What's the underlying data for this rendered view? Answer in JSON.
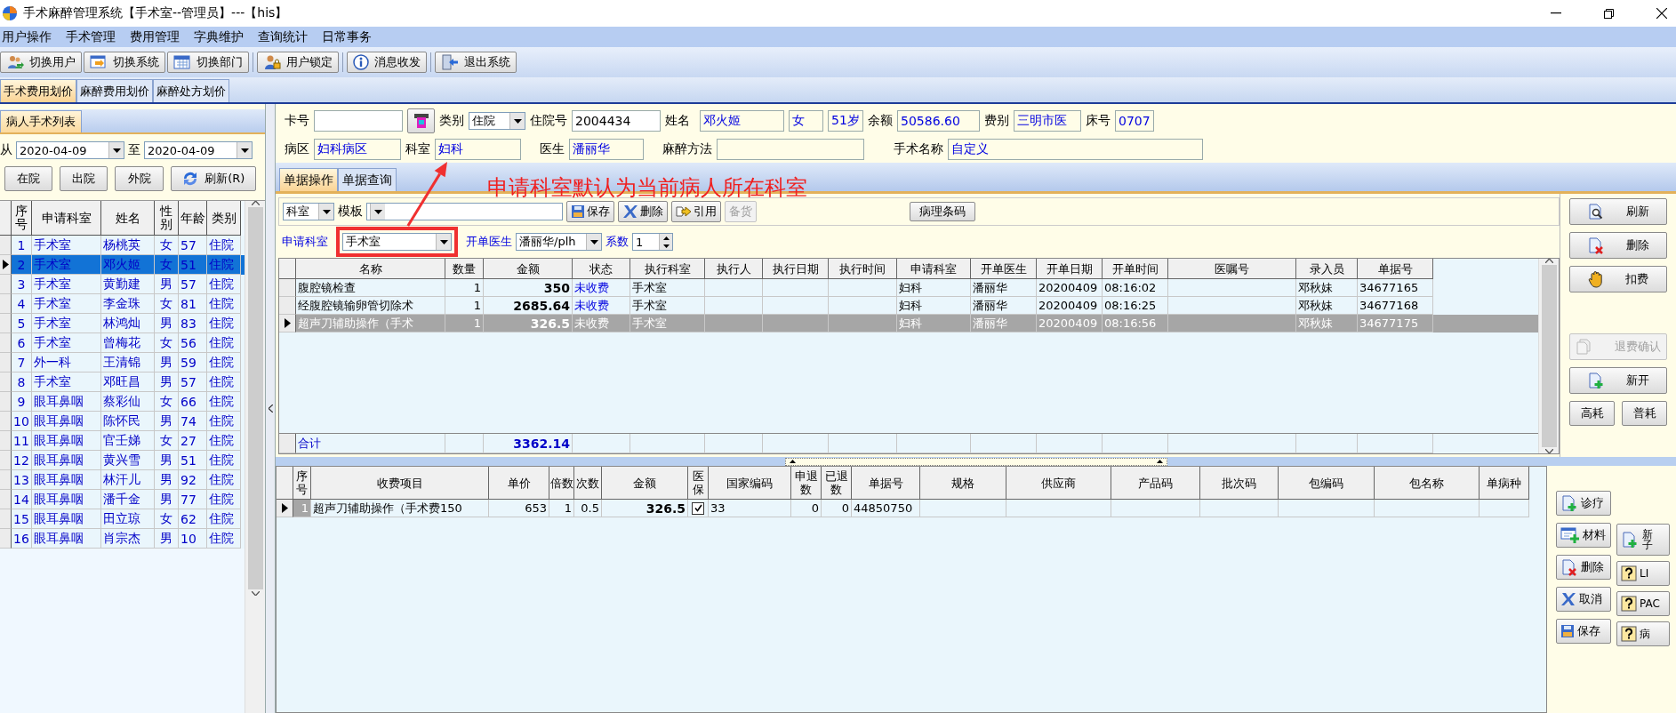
{
  "window": {
    "title": "手术麻醉管理系统【手术室--管理员】---【his】"
  },
  "menu": [
    "用户操作",
    "手术管理",
    "费用管理",
    "字典维护",
    "查询统计",
    "日常事务"
  ],
  "toolbar": [
    "切换用户",
    "切换系统",
    "切换部门",
    "用户锁定",
    "消息收发",
    "退出系统"
  ],
  "main_tabs": [
    {
      "label": "手术费用划价",
      "selected": true
    },
    {
      "label": "麻醉费用划价",
      "selected": false
    },
    {
      "label": "麻醉处方划价",
      "selected": false
    }
  ],
  "left_panel": {
    "title": "病人手术列表",
    "from_label": "从",
    "from_date": "2020-04-09",
    "to_label": "至",
    "to_date": "2020-04-09",
    "buttons": [
      "在院",
      "出院",
      "外院"
    ],
    "refresh_button": "刷新(R)",
    "columns": [
      "序号",
      "申请科室",
      "姓名",
      "性别",
      "年龄",
      "类别"
    ],
    "rows": [
      {
        "cells": [
          "1",
          "手术室",
          "杨桃英",
          "女",
          "57",
          "住院"
        ],
        "selected": false
      },
      {
        "cells": [
          "2",
          "手术室",
          "邓火姬",
          "女",
          "51",
          "住院"
        ],
        "selected": true
      },
      {
        "cells": [
          "3",
          "手术室",
          "黄勤建",
          "男",
          "57",
          "住院"
        ],
        "selected": false
      },
      {
        "cells": [
          "4",
          "手术室",
          "李金珠",
          "女",
          "81",
          "住院"
        ],
        "selected": false
      },
      {
        "cells": [
          "5",
          "手术室",
          "林鸿灿",
          "男",
          "83",
          "住院"
        ],
        "selected": false
      },
      {
        "cells": [
          "6",
          "手术室",
          "曾梅花",
          "女",
          "56",
          "住院"
        ],
        "selected": false
      },
      {
        "cells": [
          "7",
          "外一科",
          "王清锦",
          "男",
          "59",
          "住院"
        ],
        "selected": false
      },
      {
        "cells": [
          "8",
          "手术室",
          "邓旺昌",
          "男",
          "57",
          "住院"
        ],
        "selected": false
      },
      {
        "cells": [
          "9",
          "眼耳鼻咽",
          "蔡彩仙",
          "女",
          "66",
          "住院"
        ],
        "selected": false
      },
      {
        "cells": [
          "10",
          "眼耳鼻咽",
          "陈怀民",
          "男",
          "74",
          "住院"
        ],
        "selected": false
      },
      {
        "cells": [
          "11",
          "眼耳鼻咽",
          "官壬娣",
          "女",
          "27",
          "住院"
        ],
        "selected": false
      },
      {
        "cells": [
          "12",
          "眼耳鼻咽",
          "黄兴雪",
          "男",
          "51",
          "住院"
        ],
        "selected": false
      },
      {
        "cells": [
          "13",
          "眼耳鼻咽",
          "林汗儿",
          "男",
          "92",
          "住院"
        ],
        "selected": false
      },
      {
        "cells": [
          "14",
          "眼耳鼻咽",
          "潘千金",
          "男",
          "77",
          "住院"
        ],
        "selected": false
      },
      {
        "cells": [
          "15",
          "眼耳鼻咽",
          "田立琼",
          "女",
          "62",
          "住院"
        ],
        "selected": false
      },
      {
        "cells": [
          "16",
          "眼耳鼻咽",
          "肖宗杰",
          "男",
          "10",
          "住院"
        ],
        "selected": false
      }
    ]
  },
  "patient_form": {
    "first_line": [
      {
        "kind": "input",
        "label": "卡号"
      },
      {
        "kind": "reader"
      },
      {
        "kind": "combo",
        "label": "类别",
        "value": "住院"
      },
      {
        "kind": "input",
        "label": "住院号",
        "value": "2004434"
      },
      {
        "kind": "display",
        "label": "姓名",
        "value": "邓火姬"
      },
      {
        "kind": "display",
        "value": "女"
      },
      {
        "kind": "display",
        "value": "51岁"
      },
      {
        "kind": "display",
        "label": "余额",
        "value": "50586.60"
      },
      {
        "kind": "display",
        "label": "费别",
        "value": "三明市医"
      },
      {
        "kind": "display",
        "label": "床号",
        "value": "0707"
      }
    ],
    "second_line": [
      {
        "kind": "display",
        "label": "病区",
        "value": "妇科病区"
      },
      {
        "kind": "display",
        "label": "科室",
        "value": "妇科"
      },
      {
        "kind": "display",
        "label": "医生",
        "value": "潘丽华"
      },
      {
        "kind": "display",
        "label": "麻醉方法"
      },
      {
        "kind": "display",
        "label": "手术名称",
        "value": "自定义"
      }
    ]
  },
  "annotation": {
    "text": "申请科室默认为当前病人所在科室"
  },
  "sub_tabs": [
    {
      "label": "单据操作",
      "selected": true
    },
    {
      "label": "单据查询",
      "selected": false
    }
  ],
  "order_toolbar": {
    "dept_combo": "科室",
    "template_label": "模板",
    "buttons": [
      {
        "label": "保存",
        "disabled": false
      },
      {
        "label": "删除",
        "disabled": false
      },
      {
        "label": "引用",
        "disabled": false
      },
      {
        "label": "备货",
        "disabled": true
      }
    ],
    "pathology_button": "病理条码"
  },
  "order_filter": {
    "dept_label": "申请科室",
    "dept_value": "手术室",
    "doctor_label": "开单医生",
    "doctor_value": "潘丽华/plh",
    "factor_label": "系数",
    "factor_value": "1"
  },
  "orders": {
    "columns": [
      "名称",
      "数量",
      "金额",
      "状态",
      "执行科室",
      "执行人",
      "执行日期",
      "执行时间",
      "申请科室",
      "开单医生",
      "开单日期",
      "开单时间",
      "医嘱号",
      "录入员",
      "单据号"
    ],
    "rows": [
      {
        "selected": false,
        "cells": [
          "腹腔镜检查",
          "1",
          "350",
          "未收费",
          "手术室",
          "",
          "",
          "",
          "妇科",
          "潘丽华",
          "20200409",
          "08:16:02",
          "",
          "邓秋妹",
          "34677165"
        ]
      },
      {
        "selected": false,
        "cells": [
          "经腹腔镜输卵管切除术",
          "1",
          "2685.64",
          "未收费",
          "手术室",
          "",
          "",
          "",
          "妇科",
          "潘丽华",
          "20200409",
          "08:16:25",
          "",
          "邓秋妹",
          "34677168"
        ]
      },
      {
        "selected": true,
        "cells": [
          "超声刀辅助操作（手术",
          "1",
          "326.5",
          "未收费",
          "手术室",
          "",
          "",
          "",
          "妇科",
          "潘丽华",
          "20200409",
          "08:16:56",
          "",
          "邓秋妹",
          "34677175"
        ]
      }
    ],
    "total": {
      "label": "合计",
      "amount": "3362.14"
    }
  },
  "order_buttons": [
    {
      "label": "刷新",
      "disabled": false
    },
    {
      "label": "删除",
      "disabled": false
    },
    {
      "label": "扣费",
      "disabled": false
    },
    {
      "label": "退费确认",
      "disabled": true
    },
    {
      "label": "新开",
      "disabled": false
    }
  ],
  "consumable_buttons": [
    "高耗",
    "普耗"
  ],
  "items": {
    "columns": [
      "序号",
      "收费项目",
      "单价",
      "倍数",
      "次数",
      "金额",
      "医保",
      "国家编码",
      "申退数",
      "已退数",
      "单据号",
      "规格",
      "供应商",
      "产品码",
      "批次码",
      "包编码",
      "包名称",
      "单病种"
    ],
    "rows": [
      {
        "selected": true,
        "insured": true,
        "cells": [
          "1",
          "超声刀辅助操作（手术费150",
          "653",
          "1",
          "0.5",
          "326.5",
          "",
          "33",
          "0",
          "0",
          "44850750",
          "",
          "",
          "",
          "",
          "",
          "",
          ""
        ]
      }
    ]
  },
  "item_buttons": [
    "诊疗",
    "材料",
    "删除",
    "取消",
    "保存"
  ],
  "item_side_buttons": [
    "新子",
    "LI",
    "PAC",
    "病"
  ]
}
